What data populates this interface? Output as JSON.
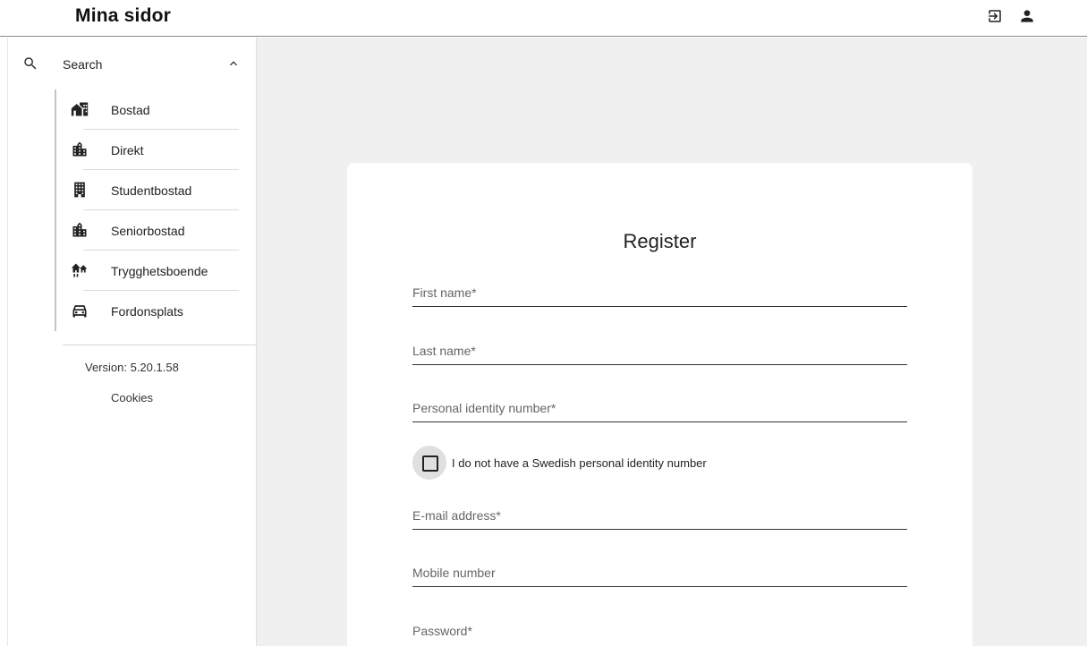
{
  "header": {
    "brand": "Mina sidor",
    "icons": [
      "login-icon",
      "account-icon"
    ]
  },
  "sidebar": {
    "search_label": "Search",
    "items": [
      {
        "label": "Bostad",
        "icon": "house-icon"
      },
      {
        "label": "Direkt",
        "icon": "city-icon"
      },
      {
        "label": "Studentbostad",
        "icon": "apartment-building-icon"
      },
      {
        "label": "Seniorbostad",
        "icon": "city-icon"
      },
      {
        "label": "Trygghetsboende",
        "icon": "family-home-icon"
      },
      {
        "label": "Fordonsplats",
        "icon": "car-icon"
      }
    ],
    "version": "Version: 5.20.1.58",
    "cookies": "Cookies"
  },
  "form": {
    "title": "Register",
    "first_name_placeholder": "First name*",
    "last_name_placeholder": "Last name*",
    "pin_placeholder": "Personal identity number*",
    "no_pin_label": "I do not have a Swedish personal identity number",
    "email_placeholder": "E-mail address*",
    "mobile_placeholder": "Mobile number",
    "password_placeholder": "Password*"
  }
}
